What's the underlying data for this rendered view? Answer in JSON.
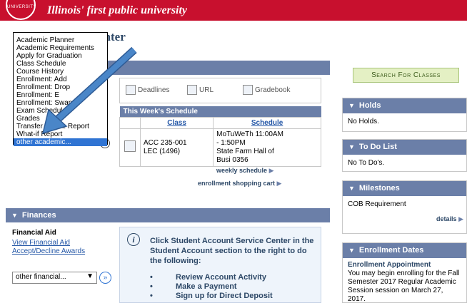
{
  "header": {
    "seal_text": "UNIVERSITY",
    "tagline": "Illinois' first public university"
  },
  "page": {
    "title_partial": "enter"
  },
  "academic_menu": {
    "items": [
      "Academic Planner",
      "Academic Requirements",
      "Apply for Graduation",
      "Class Schedule",
      "Course History",
      "Enrollment: Add",
      "Enrollment: Drop",
      "Enrollment: E",
      "Enrollment: Swap",
      "Exam Schedule",
      "Grades",
      "Transfer Credit: Report",
      "What-if Report",
      "other academic..."
    ],
    "selected": "other academic..."
  },
  "tools": {
    "deadlines": "Deadlines",
    "url": "URL",
    "gradebook": "Gradebook"
  },
  "schedule": {
    "title": "This Week's Schedule",
    "col_class": "Class",
    "col_schedule": "Schedule",
    "row": {
      "class_line1": "ACC 235-001",
      "class_line2": "LEC (1496)",
      "sched_line1": "MoTuWeTh 11:00AM",
      "sched_line2": "- 1:50PM",
      "sched_line3": "State Farm Hall of",
      "sched_line4": "Busi 0356"
    },
    "weekly_link": "weekly schedule",
    "cart_link": "enrollment shopping cart"
  },
  "finances": {
    "title": "Finances",
    "aid_heading": "Financial Aid",
    "view_link": "View Financial Aid",
    "accept_link": "Accept/Decline Awards",
    "select_value": "other financial...",
    "info_text": "Click Student Account Service Center in the Student Account section to the right to do the following:",
    "info_items": [
      "Review Account Activity",
      "Make a Payment",
      "Sign up for Direct Deposit"
    ]
  },
  "right": {
    "search_button": "Search For Classes",
    "holds": {
      "title": "Holds",
      "body": "No Holds."
    },
    "todo": {
      "title": "To Do List",
      "body": "No To Do's."
    },
    "milestones": {
      "title": "Milestones",
      "body": "COB Requirement",
      "details": "details"
    },
    "enrollment": {
      "title": "Enrollment Dates",
      "heading": "Enrollment Appointment",
      "body": "You may begin enrolling for the Fall Semester 2017 Regular Academic Session session on March 27, 2017."
    }
  },
  "colors": {
    "brand_red": "#c8102e",
    "header_bar": "#6b7fa8",
    "link_blue": "#2356a6",
    "selected_item": "#3074d3",
    "annotation_arrow": "#4a86c8"
  }
}
